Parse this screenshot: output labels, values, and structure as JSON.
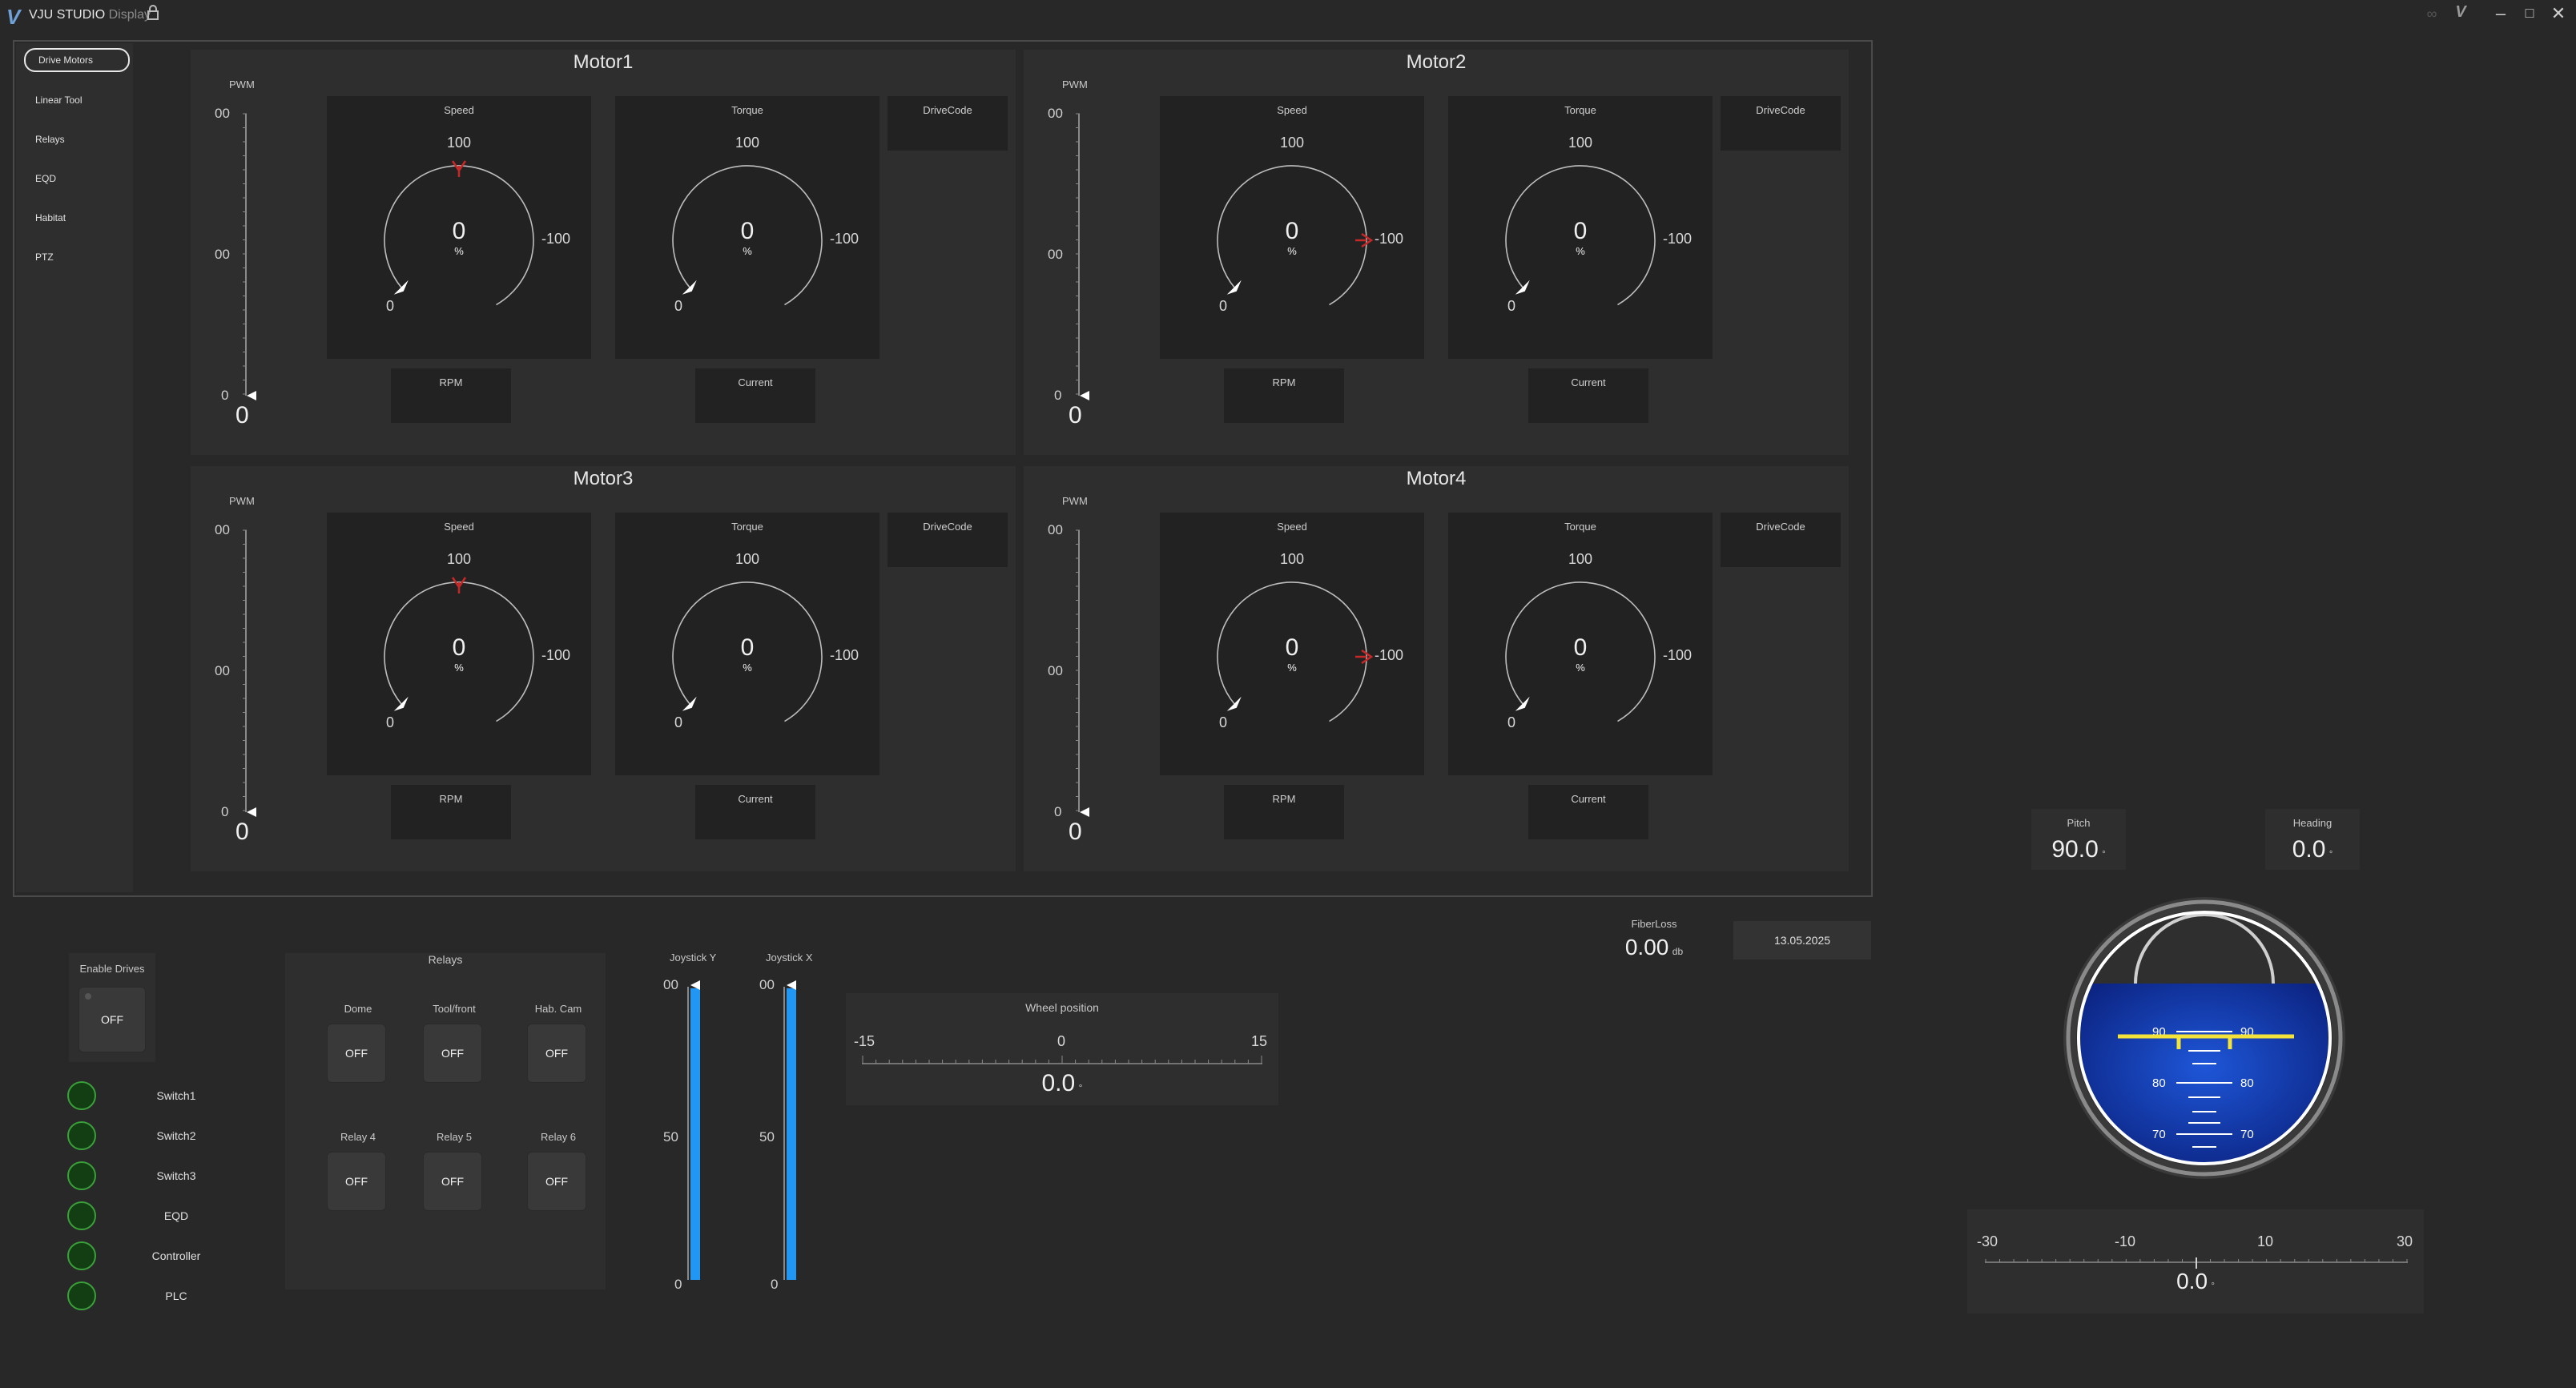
{
  "app": {
    "brand": "VJU",
    "title_main": "STUDIO",
    "title_sub": "Display"
  },
  "nav": {
    "items": [
      "Drive Motors",
      "Linear Tool",
      "Relays",
      "EQD",
      "Habitat",
      "PTZ"
    ]
  },
  "motors": [
    {
      "title": "Motor1",
      "pwm_label": "PWM",
      "pwm_top": "00",
      "pwm_mid": "00",
      "pwm_zero": "0",
      "pwm_value": "0",
      "speed": {
        "label": "Speed",
        "max": "100",
        "min": "-100",
        "zero": "0",
        "value": "0",
        "unit": "%"
      },
      "torque": {
        "label": "Torque",
        "max": "100",
        "min": "-100",
        "zero": "0",
        "value": "0",
        "unit": "%"
      },
      "drivecode": "DriveCode",
      "rpm": "RPM",
      "current": "Current"
    },
    {
      "title": "Motor2",
      "pwm_label": "PWM",
      "pwm_top": "00",
      "pwm_mid": "00",
      "pwm_zero": "0",
      "pwm_value": "0",
      "speed": {
        "label": "Speed",
        "max": "100",
        "min": "-100",
        "zero": "0",
        "value": "0",
        "unit": "%"
      },
      "torque": {
        "label": "Torque",
        "max": "100",
        "min": "-100",
        "zero": "0",
        "value": "0",
        "unit": "%"
      },
      "drivecode": "DriveCode",
      "rpm": "RPM",
      "current": "Current"
    },
    {
      "title": "Motor3",
      "pwm_label": "PWM",
      "pwm_top": "00",
      "pwm_mid": "00",
      "pwm_zero": "0",
      "pwm_value": "0",
      "speed": {
        "label": "Speed",
        "max": "100",
        "min": "-100",
        "zero": "0",
        "value": "0",
        "unit": "%"
      },
      "torque": {
        "label": "Torque",
        "max": "100",
        "min": "-100",
        "zero": "0",
        "value": "0",
        "unit": "%"
      },
      "drivecode": "DriveCode",
      "rpm": "RPM",
      "current": "Current"
    },
    {
      "title": "Motor4",
      "pwm_label": "PWM",
      "pwm_top": "00",
      "pwm_mid": "00",
      "pwm_zero": "0",
      "pwm_value": "0",
      "speed": {
        "label": "Speed",
        "max": "100",
        "min": "-100",
        "zero": "0",
        "value": "0",
        "unit": "%"
      },
      "torque": {
        "label": "Torque",
        "max": "100",
        "min": "-100",
        "zero": "0",
        "value": "0",
        "unit": "%"
      },
      "drivecode": "DriveCode",
      "rpm": "RPM",
      "current": "Current"
    }
  ],
  "enable_drives": {
    "label": "Enable Drives",
    "state": "OFF"
  },
  "indicators": [
    "Switch1",
    "Switch2",
    "Switch3",
    "EQD",
    "Controller",
    "PLC"
  ],
  "relays": {
    "title": "Relays",
    "items": [
      {
        "label": "Dome",
        "state": "OFF"
      },
      {
        "label": "Tool/front",
        "state": "OFF"
      },
      {
        "label": "Hab. Cam",
        "state": "OFF"
      },
      {
        "label": "Relay 4",
        "state": "OFF"
      },
      {
        "label": "Relay 5",
        "state": "OFF"
      },
      {
        "label": "Relay 6",
        "state": "OFF"
      }
    ]
  },
  "joystick_y": {
    "label": "Joystick Y",
    "top": "00",
    "mid": "50",
    "bottom": "0"
  },
  "joystick_x": {
    "label": "Joystick X",
    "top": "00",
    "mid": "50",
    "bottom": "0"
  },
  "wheel": {
    "title": "Wheel position",
    "min": "-15",
    "mid": "0",
    "max": "15",
    "value": "0.0",
    "unit": "°"
  },
  "fiberloss": {
    "label": "FiberLoss",
    "value": "0.00",
    "unit": "db"
  },
  "date": "13.05.2025",
  "pitch": {
    "label": "Pitch",
    "value": "90.0",
    "unit": "°"
  },
  "heading": {
    "label": "Heading",
    "value": "0.0",
    "unit": "°"
  },
  "attitude": {
    "labels": [
      "90",
      "90",
      "80",
      "80",
      "70",
      "70"
    ]
  },
  "roll": {
    "ticks": [
      "-30",
      "-10",
      "10",
      "30"
    ],
    "value": "0.0",
    "unit": "°"
  },
  "colors": {
    "accent": "#2196f3",
    "needle_red": "#c62828",
    "horizon_yellow": "#f3e23a",
    "led_green": "#3aa03a"
  }
}
